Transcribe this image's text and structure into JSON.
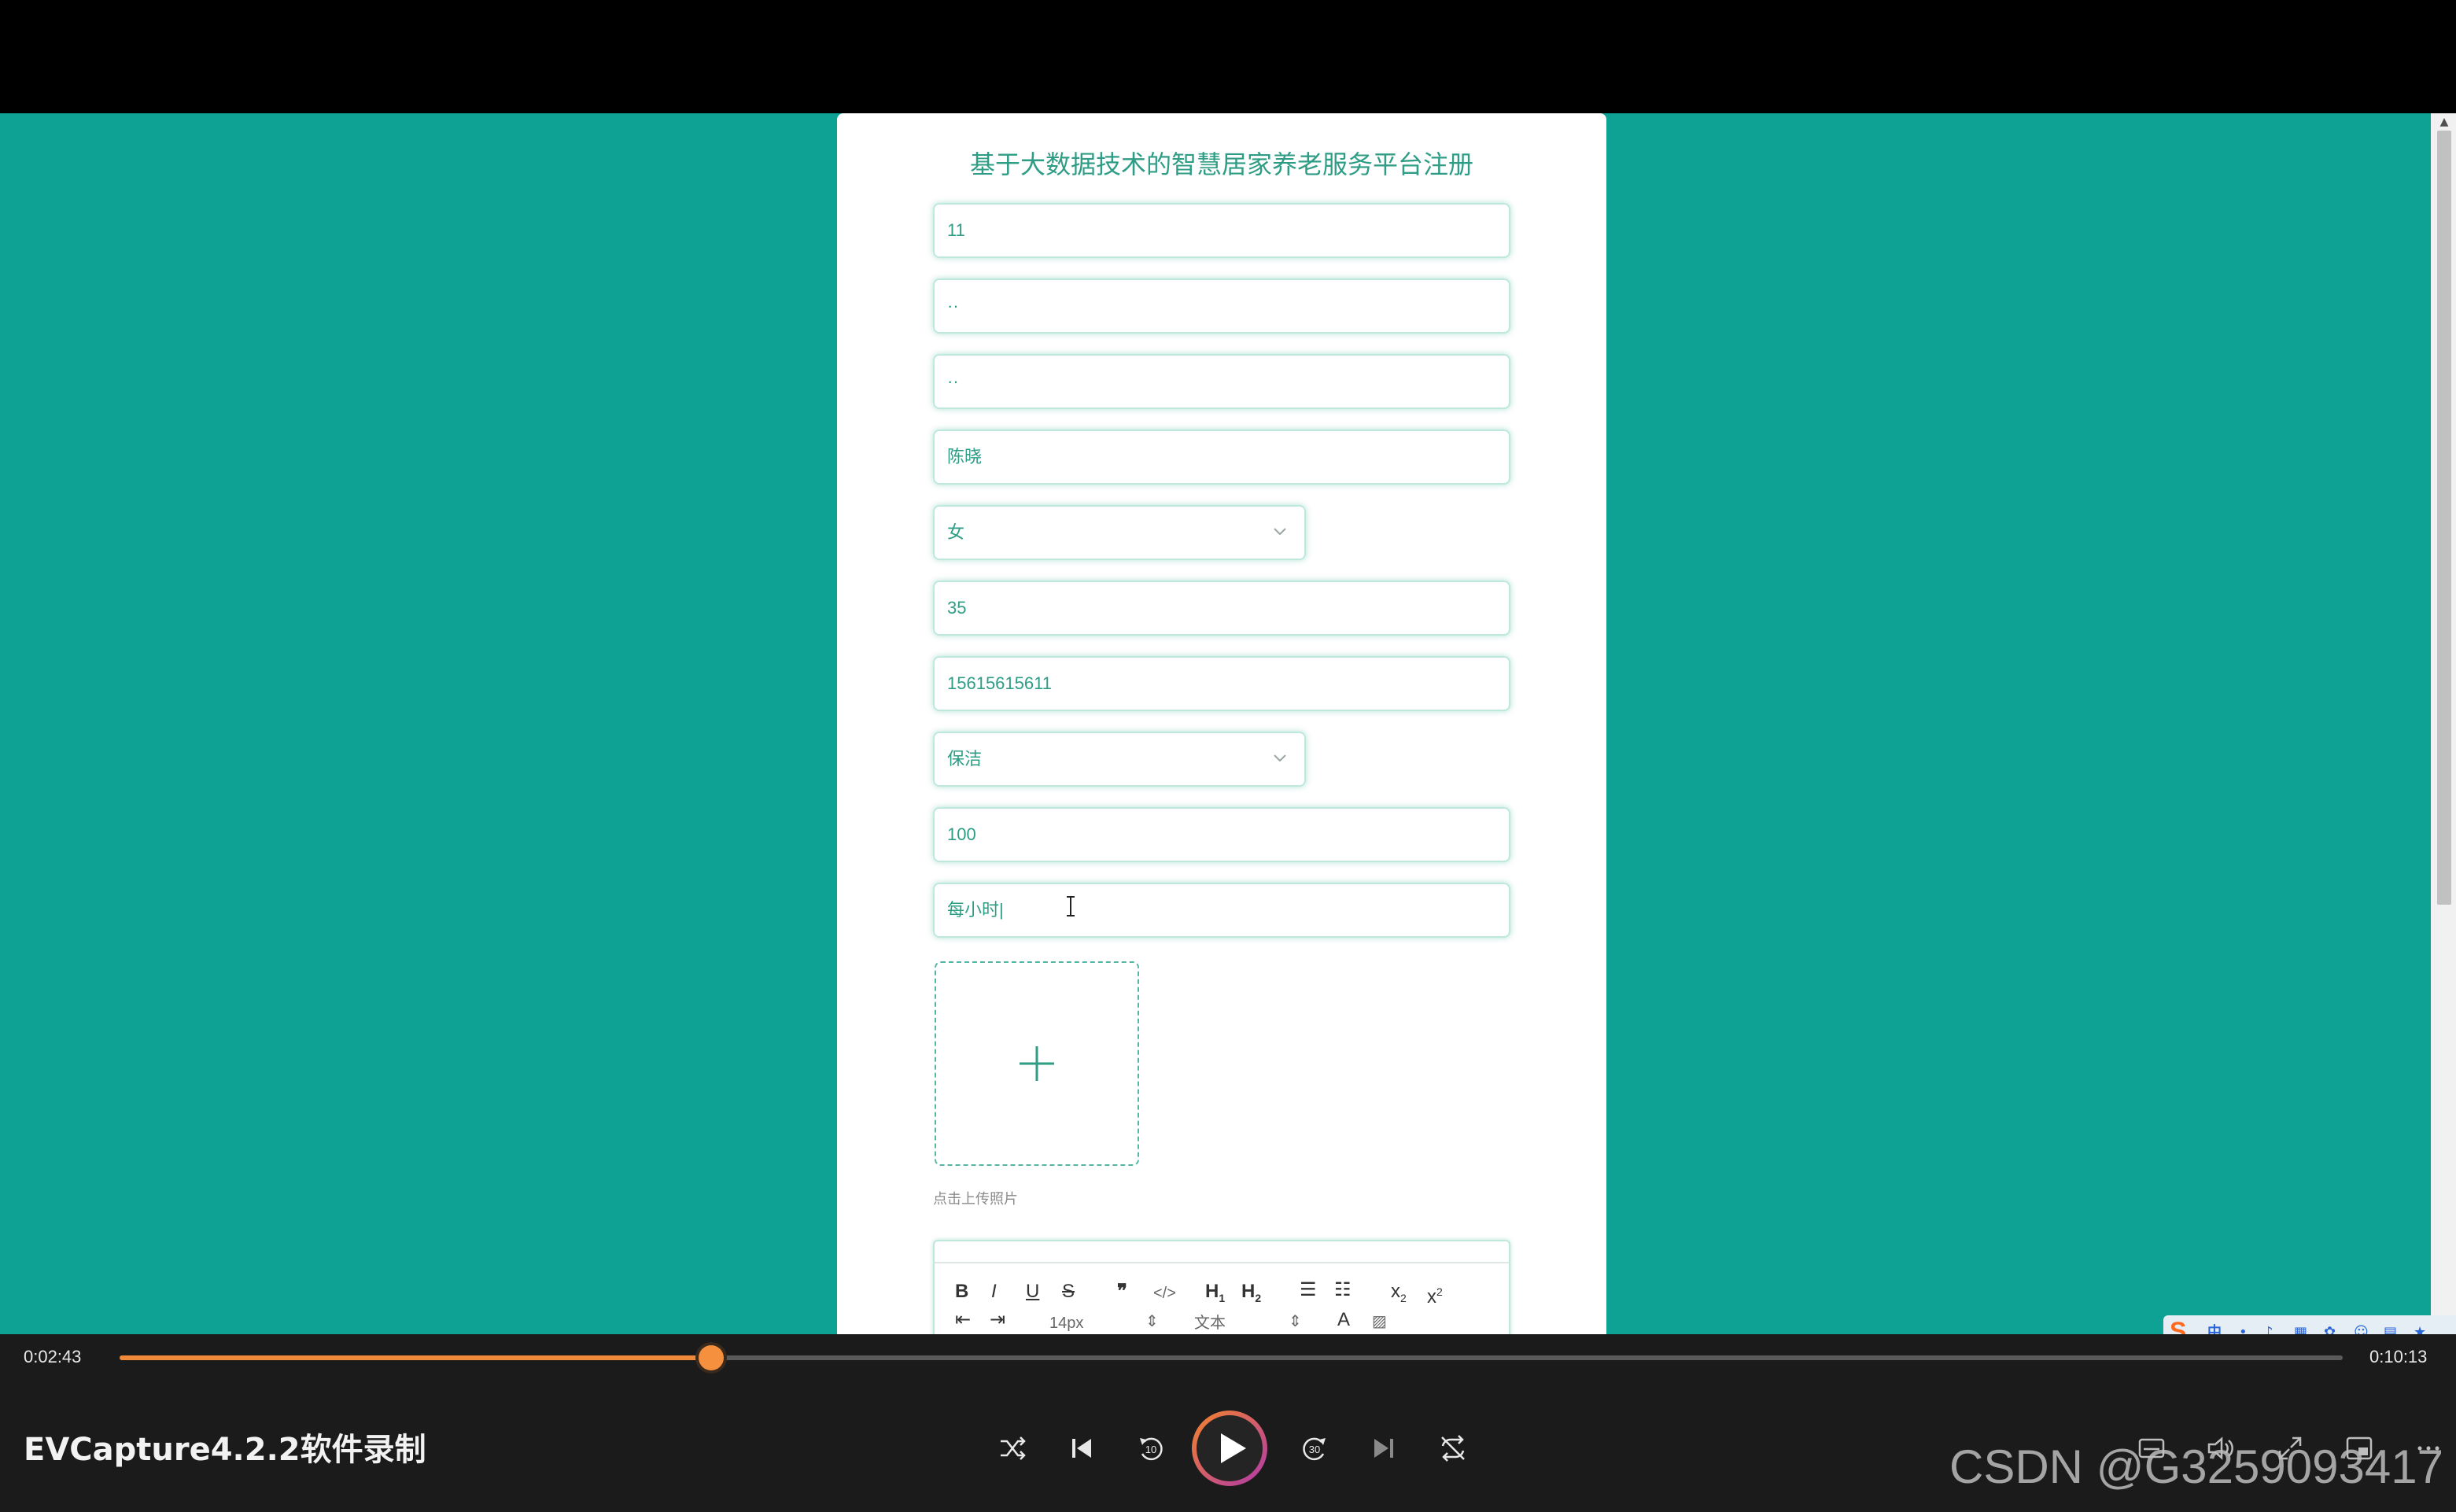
{
  "form": {
    "title": "基于大数据技术的智慧居家养老服务平台注册",
    "fields": [
      {
        "value": "11"
      },
      {
        "value": "··"
      },
      {
        "value": "··"
      },
      {
        "value": "陈晓"
      },
      {
        "value": "女"
      },
      {
        "value": "35"
      },
      {
        "value": "15615615611"
      },
      {
        "value": "保洁"
      },
      {
        "value": "100"
      },
      {
        "value": "每小时|"
      }
    ],
    "upload_hint": "点击上传照片",
    "editor_toolbar": {
      "font_size": "14px",
      "block_type": "文本"
    }
  },
  "player": {
    "current_time": "0:02:43",
    "total_time": "0:10:13",
    "progress": 0.266,
    "title": "EVCapture4.2.2软件录制"
  },
  "watermark": "CSDN @G3259093417",
  "ime": {
    "mode": "中"
  },
  "colors": {
    "page_bg": "#0ea294",
    "accent": "#2f9d86",
    "progress": "#f08a3a"
  }
}
